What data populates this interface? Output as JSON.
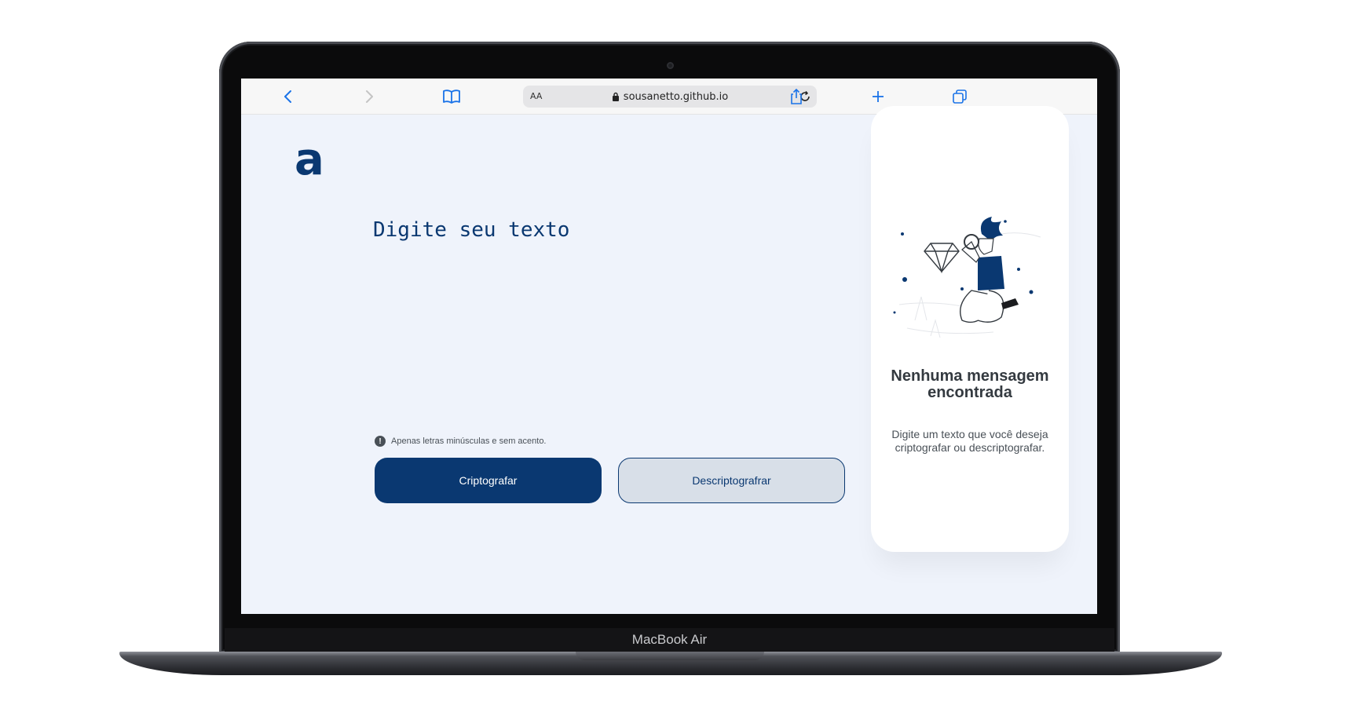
{
  "device": {
    "model_label": "MacBook Air"
  },
  "browser": {
    "text_size_label": "AA",
    "url": "sousanetto.github.io",
    "icons": [
      "chevron-left-icon",
      "chevron-right-icon",
      "book-icon",
      "lock-icon",
      "reload-icon",
      "share-icon",
      "plus-icon",
      "tabs-icon"
    ]
  },
  "page": {
    "logo": "a",
    "input": {
      "placeholder": "Digite seu texto",
      "value": ""
    },
    "hint": "Apenas letras minúsculas e sem acento.",
    "hint_icon": "!",
    "buttons": {
      "encrypt": "Criptografar",
      "decrypt": "Descriptografrar"
    },
    "output": {
      "title": "Nenhuma mensagem encontrada",
      "text": "Digite um texto que você deseja criptografar ou descriptografar."
    }
  },
  "colors": {
    "accent": "#0a3871",
    "page_background": "#eff3fb",
    "secondary_button": "#d8dfe8",
    "panel": "#ffffff"
  }
}
